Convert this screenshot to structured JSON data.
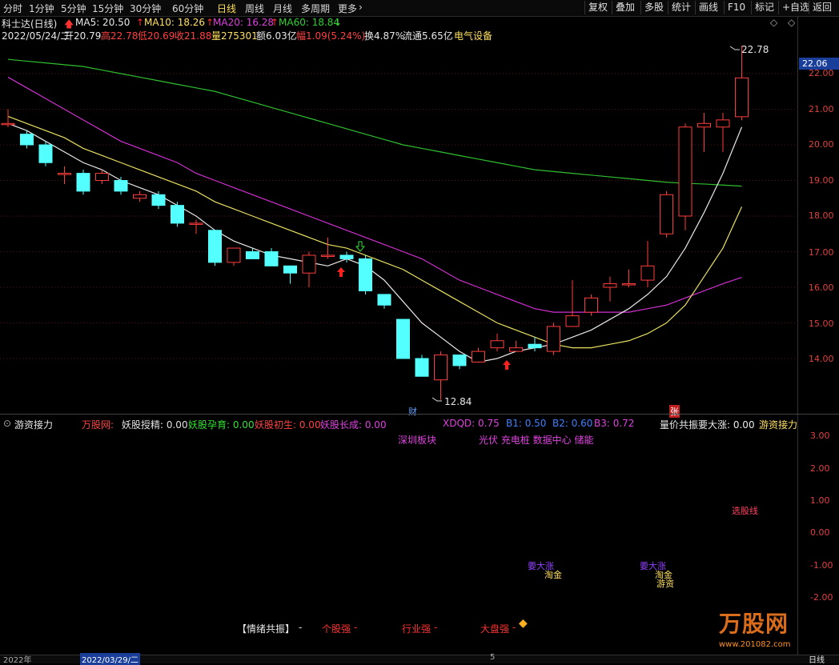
{
  "toolbar": {
    "tabs": [
      "分时",
      "1分钟",
      "5分钟",
      "15分钟",
      "30分钟",
      "60分钟",
      "日线",
      "周线",
      "月线",
      "多周期",
      "更多"
    ],
    "active": "日线",
    "more_arrow": "›",
    "right_buttons": [
      "复权",
      "叠加",
      "多股",
      "统计",
      "画线",
      "F10",
      "标记",
      "+自选",
      "返回"
    ]
  },
  "header": {
    "stock": "科士达(日线)",
    "ma5": "MA5: 20.50",
    "ma10": "MA10: 18.26",
    "ma20": "MA20: 16.28",
    "ma60": "MA60: 18.84",
    "date": "2022/05/24/二",
    "open": "开20.79",
    "high": "高22.78",
    "low": "低20.69",
    "close": "收21.88",
    "volume": "量275301",
    "amount": "额6.03亿",
    "change": "幅1.09(5.24%)",
    "turnover": "换4.87%",
    "float": "流通5.65亿",
    "sector": "电气设备",
    "diamond1": "◇",
    "diamond2": "◇"
  },
  "chart_data": {
    "type": "candlestick",
    "ylim": [
      13.0,
      22.6
    ],
    "y_ticks": [
      "22.00",
      "21.00",
      "20.00",
      "19.00",
      "18.00",
      "17.00",
      "16.00",
      "15.00",
      "14.00"
    ],
    "current_price": "22.06",
    "max_label": "22.78",
    "min_label": "12.84",
    "marker_cai": "财",
    "marker_zhang": "张",
    "candles": [
      {
        "o": 20.6,
        "c": 20.6,
        "h": 21.0,
        "l": 20.5
      },
      {
        "o": 20.3,
        "c": 20.0,
        "h": 20.4,
        "l": 19.9
      },
      {
        "o": 20.0,
        "c": 19.5,
        "h": 20.1,
        "l": 19.4
      },
      {
        "o": 19.2,
        "c": 19.2,
        "h": 19.4,
        "l": 18.9
      },
      {
        "o": 19.2,
        "c": 18.7,
        "h": 19.3,
        "l": 18.6
      },
      {
        "o": 19.0,
        "c": 19.2,
        "h": 19.3,
        "l": 18.9
      },
      {
        "o": 19.0,
        "c": 18.7,
        "h": 19.1,
        "l": 18.6
      },
      {
        "o": 18.5,
        "c": 18.6,
        "h": 18.7,
        "l": 18.4
      },
      {
        "o": 18.6,
        "c": 18.3,
        "h": 18.7,
        "l": 18.2
      },
      {
        "o": 18.3,
        "c": 17.8,
        "h": 18.4,
        "l": 17.7
      },
      {
        "o": 17.8,
        "c": 17.8,
        "h": 17.9,
        "l": 17.5
      },
      {
        "o": 17.6,
        "c": 16.7,
        "h": 17.6,
        "l": 16.6
      },
      {
        "o": 16.7,
        "c": 17.1,
        "h": 17.1,
        "l": 16.6
      },
      {
        "o": 17.0,
        "c": 16.8,
        "h": 17.1,
        "l": 16.8
      },
      {
        "o": 17.0,
        "c": 16.6,
        "h": 17.1,
        "l": 16.6
      },
      {
        "o": 16.6,
        "c": 16.4,
        "h": 16.6,
        "l": 16.1
      },
      {
        "o": 16.4,
        "c": 16.9,
        "h": 17.0,
        "l": 16.0
      },
      {
        "o": 16.9,
        "c": 16.9,
        "h": 17.4,
        "l": 16.8
      },
      {
        "o": 16.9,
        "c": 16.8,
        "h": 17.0,
        "l": 16.7
      },
      {
        "o": 16.8,
        "c": 15.9,
        "h": 16.9,
        "l": 15.8
      },
      {
        "o": 15.8,
        "c": 15.5,
        "h": 15.8,
        "l": 15.4
      },
      {
        "o": 15.1,
        "c": 14.0,
        "h": 15.1,
        "l": 14.0
      },
      {
        "o": 14.0,
        "c": 13.5,
        "h": 14.1,
        "l": 13.5
      },
      {
        "o": 13.4,
        "c": 14.1,
        "h": 14.2,
        "l": 12.84
      },
      {
        "o": 14.1,
        "c": 13.8,
        "h": 14.1,
        "l": 13.7
      },
      {
        "o": 13.9,
        "c": 14.2,
        "h": 14.3,
        "l": 13.9
      },
      {
        "o": 14.3,
        "c": 14.5,
        "h": 14.7,
        "l": 14.2
      },
      {
        "o": 14.2,
        "c": 14.3,
        "h": 14.5,
        "l": 14.2
      },
      {
        "o": 14.4,
        "c": 14.3,
        "h": 14.6,
        "l": 14.2
      },
      {
        "o": 14.2,
        "c": 14.9,
        "h": 15.0,
        "l": 14.1
      },
      {
        "o": 14.9,
        "c": 15.2,
        "h": 16.2,
        "l": 14.9
      },
      {
        "o": 15.3,
        "c": 15.7,
        "h": 15.8,
        "l": 15.2
      },
      {
        "o": 16.0,
        "c": 16.1,
        "h": 16.3,
        "l": 15.6
      },
      {
        "o": 16.1,
        "c": 16.1,
        "h": 16.5,
        "l": 16.0
      },
      {
        "o": 16.2,
        "c": 16.6,
        "h": 17.3,
        "l": 16.0
      },
      {
        "o": 17.5,
        "c": 18.6,
        "h": 18.7,
        "l": 17.4
      },
      {
        "o": 18.0,
        "c": 20.5,
        "h": 20.6,
        "l": 17.6
      },
      {
        "o": 20.5,
        "c": 20.6,
        "h": 20.9,
        "l": 19.8
      },
      {
        "o": 20.5,
        "c": 20.7,
        "h": 20.9,
        "l": 19.8
      },
      {
        "o": 20.79,
        "c": 21.88,
        "h": 22.78,
        "l": 20.69
      }
    ],
    "ma5": [
      20.6,
      20.4,
      20.1,
      19.8,
      19.5,
      19.3,
      19.0,
      18.8,
      18.6,
      18.3,
      18.0,
      17.6,
      17.3,
      17.1,
      16.9,
      16.8,
      16.7,
      16.6,
      16.8,
      16.6,
      16.2,
      15.6,
      15.0,
      14.6,
      14.2,
      13.9,
      14.0,
      14.2,
      14.3,
      14.4,
      14.6,
      14.8,
      15.1,
      15.4,
      15.8,
      16.3,
      17.1,
      18.1,
      19.2,
      20.5
    ],
    "ma10": [
      20.8,
      20.6,
      20.4,
      20.2,
      19.9,
      19.7,
      19.5,
      19.3,
      19.1,
      18.9,
      18.7,
      18.4,
      18.2,
      18.0,
      17.8,
      17.6,
      17.4,
      17.2,
      17.1,
      16.9,
      16.7,
      16.5,
      16.2,
      15.9,
      15.6,
      15.3,
      15.0,
      14.8,
      14.6,
      14.4,
      14.3,
      14.3,
      14.4,
      14.5,
      14.7,
      15.0,
      15.5,
      16.3,
      17.1,
      18.26
    ],
    "ma20": [
      21.9,
      21.6,
      21.3,
      21.0,
      20.7,
      20.4,
      20.1,
      19.9,
      19.7,
      19.5,
      19.2,
      19.0,
      18.8,
      18.6,
      18.4,
      18.2,
      18.0,
      17.8,
      17.6,
      17.4,
      17.2,
      17.0,
      16.8,
      16.5,
      16.2,
      16.0,
      15.8,
      15.6,
      15.4,
      15.3,
      15.3,
      15.3,
      15.3,
      15.3,
      15.4,
      15.5,
      15.7,
      15.9,
      16.1,
      16.28
    ],
    "ma60": [
      22.4,
      22.35,
      22.3,
      22.25,
      22.2,
      22.1,
      22.0,
      21.9,
      21.8,
      21.7,
      21.6,
      21.5,
      21.35,
      21.2,
      21.05,
      20.9,
      20.75,
      20.6,
      20.45,
      20.3,
      20.15,
      20.0,
      19.9,
      19.8,
      19.7,
      19.6,
      19.5,
      19.4,
      19.3,
      19.25,
      19.2,
      19.15,
      19.1,
      19.05,
      19.0,
      18.95,
      18.92,
      18.9,
      18.87,
      18.84
    ]
  },
  "indicator": {
    "name": "游资接力",
    "brand": "万股网:",
    "items": [
      {
        "label": "妖股授精: 0.00",
        "color": "#e0e0e0"
      },
      {
        "label": "妖股孕育: 0.00",
        "color": "#30e030"
      },
      {
        "label": "妖股初生: 0.00",
        "color": "#ff4040"
      },
      {
        "label": "妖股长成: 0.00",
        "color": "#e040e0"
      }
    ],
    "xdqd": "XDQD: 0.75",
    "b1": "B1: 0.50",
    "b2": "B2: 0.60",
    "b3": "B3: 0.72",
    "right_label": "量价共振要大涨: 0.00",
    "right_name": "游资接力",
    "sector1": "深圳板块",
    "sector2": "光伏 充电桩 数据中心 储能",
    "y_ticks": [
      "3.00",
      "2.00",
      "1.00",
      "0.00",
      "-1.00",
      "-2.00"
    ],
    "label_dazhang": "要大涨",
    "label_taojin": "淘金",
    "label_yaoda": "要大涨",
    "label_taojin2": "淘金",
    "label_jiehuo": "游资",
    "label_xiangu": "选股线",
    "emotion_title": "【情绪共振】",
    "emotion_dash": "-",
    "emotion_1": "个股强",
    "emotion_2": "行业强",
    "emotion_3": "大盘强",
    "emotion_sep": "-",
    "watermark": "万股网",
    "watermark_url": "www.201082.com"
  },
  "bottom_axis": {
    "year": "2022年",
    "date": "2022/03/29/二",
    "five": "5",
    "period": "日线"
  }
}
